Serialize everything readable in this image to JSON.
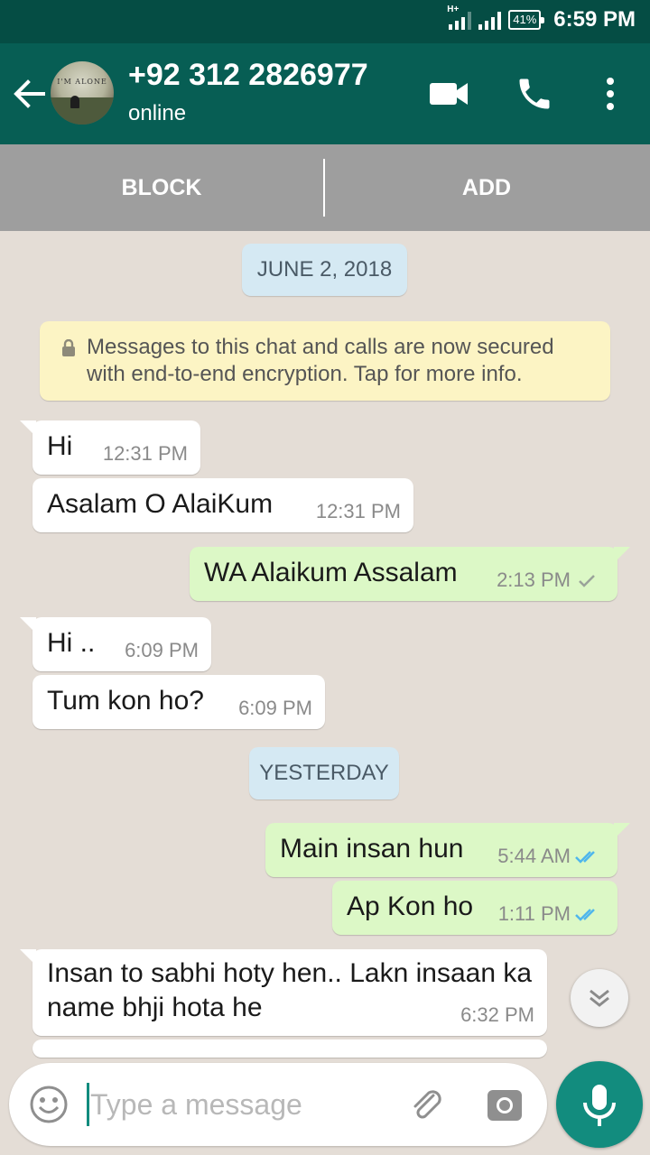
{
  "status_bar": {
    "network": "H+",
    "battery": "41%",
    "time": "6:59 PM"
  },
  "header": {
    "contact_name": "+92 312 2826977",
    "status": "online",
    "avatar_text": "I'M ALONE"
  },
  "action_bar": {
    "block_label": "BLOCK",
    "add_label": "ADD"
  },
  "chat": {
    "dates": [
      "JUNE 2, 2018",
      "YESTERDAY"
    ],
    "encryption_notice": "Messages to this chat and calls are now secured with end-to-end encryption. Tap for more info.",
    "messages": [
      {
        "direction": "in",
        "text": "Hi",
        "time": "12:31 PM"
      },
      {
        "direction": "in",
        "text": "Asalam O AlaiKum",
        "time": "12:31 PM"
      },
      {
        "direction": "out",
        "text": "WA Alaikum Assalam",
        "time": "2:13 PM",
        "status": "sent"
      },
      {
        "direction": "in",
        "text": "Hi ..",
        "time": "6:09 PM"
      },
      {
        "direction": "in",
        "text": "Tum kon ho?",
        "time": "6:09 PM"
      },
      {
        "direction": "out",
        "text": "Main insan hun",
        "time": "5:44 AM",
        "status": "read"
      },
      {
        "direction": "out",
        "text": "Ap Kon ho",
        "time": "1:11 PM",
        "status": "read"
      },
      {
        "direction": "in",
        "text": "Insan to sabhi hoty hen.. Lakn insaan ka name bhji hota he",
        "time": "6:32 PM"
      }
    ]
  },
  "input": {
    "placeholder": "Type a message"
  },
  "colors": {
    "header": "#075e54",
    "status_bar": "#054d44",
    "accent": "#128c7e",
    "outgoing_bubble": "#dcf8c6",
    "read_tick": "#4fb6ec"
  }
}
